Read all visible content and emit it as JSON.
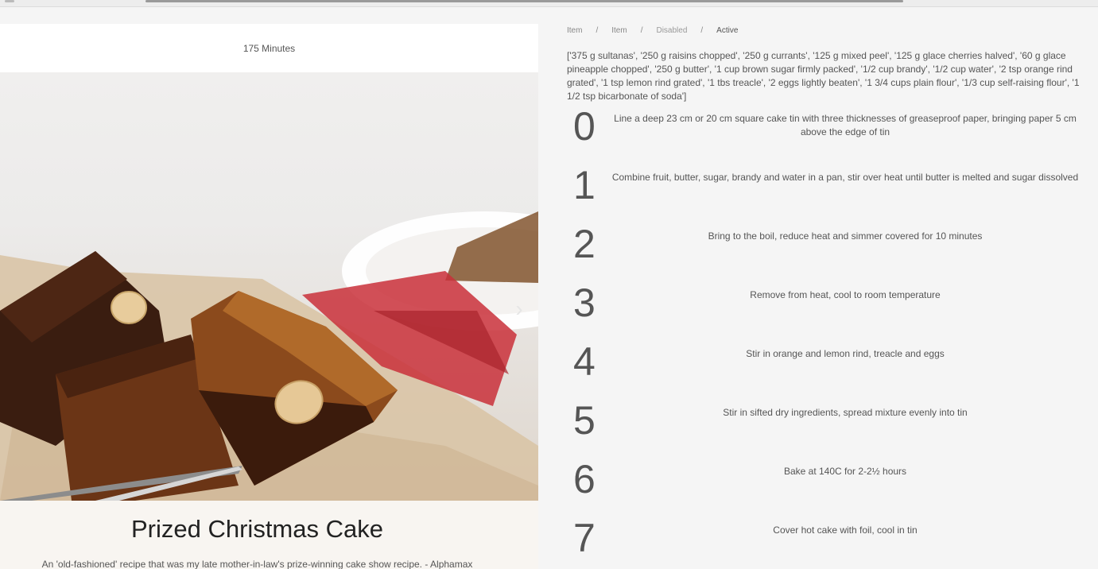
{
  "recipe": {
    "duration": "175 Minutes",
    "title": "Prized Christmas Cake",
    "description": "An 'old-fashioned' recipe that was my late mother-in-law's prize-winning cake show recipe. - Alphamax",
    "ingredients_text": "['375 g sultanas', '250 g raisins chopped', '250 g currants', '125 g mixed peel', '125 g glace cherries halved', '60 g glace pineapple chopped', '250 g butter', '1 cup brown sugar firmly packed', '1/2 cup brandy', '1/2 cup water', '2 tsp orange rind grated', '1 tsp lemon rind grated', '1 tbs treacle', '2 eggs lightly beaten', '1 3/4 cups plain flour', '1/3 cup self-raising flour', '1 1/2 tsp bicarbonate of soda']"
  },
  "breadcrumb": {
    "items": [
      "Item",
      "Item",
      "Disabled",
      "Active"
    ],
    "separator": "/"
  },
  "steps": [
    {
      "num": "0",
      "text": "Line a deep 23 cm or 20 cm square cake tin with three thicknesses of greaseproof paper, bringing paper 5 cm above the edge of tin"
    },
    {
      "num": "1",
      "text": "Combine fruit, butter, sugar, brandy and water in a pan, stir over heat until butter is melted and sugar dissolved"
    },
    {
      "num": "2",
      "text": "Bring to the boil, reduce heat and simmer covered for 10 minutes"
    },
    {
      "num": "3",
      "text": "Remove from heat, cool to room temperature"
    },
    {
      "num": "4",
      "text": "Stir in orange and lemon rind, treacle and eggs"
    },
    {
      "num": "5",
      "text": "Stir in sifted dry ingredients, spread mixture evenly into tin"
    },
    {
      "num": "6",
      "text": "Bake at 140C for 2-2½ hours"
    },
    {
      "num": "7",
      "text": "Cover hot cake with foil, cool in tin"
    }
  ],
  "icons": {
    "next": "chevron-right-icon"
  }
}
